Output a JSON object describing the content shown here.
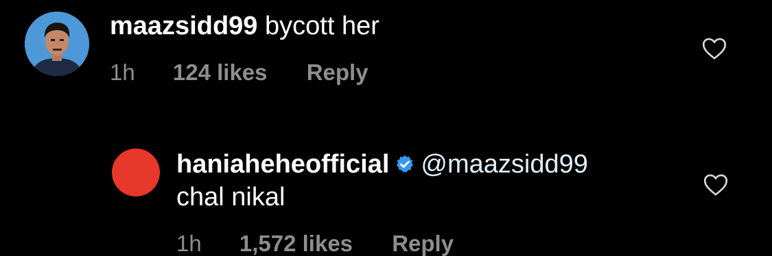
{
  "comment": {
    "username": "maazsidd99",
    "text": "bycott her",
    "time": "1h",
    "likes": "124 likes",
    "reply_label": "Reply"
  },
  "reply": {
    "username": "haniaheheofficial",
    "verified": true,
    "mention": "@maazsidd99",
    "text": "chal nikal",
    "time": "1h",
    "likes": "1,572 likes",
    "reply_label": "Reply"
  },
  "colors": {
    "background": "#000000",
    "primary_text": "#ffffff",
    "secondary_text": "#8e8e8e",
    "verified_badge": "#3897f0",
    "mention": "#e0f1ff"
  },
  "icons": {
    "like": "heart-outline-icon",
    "verified": "verified-badge-icon"
  }
}
